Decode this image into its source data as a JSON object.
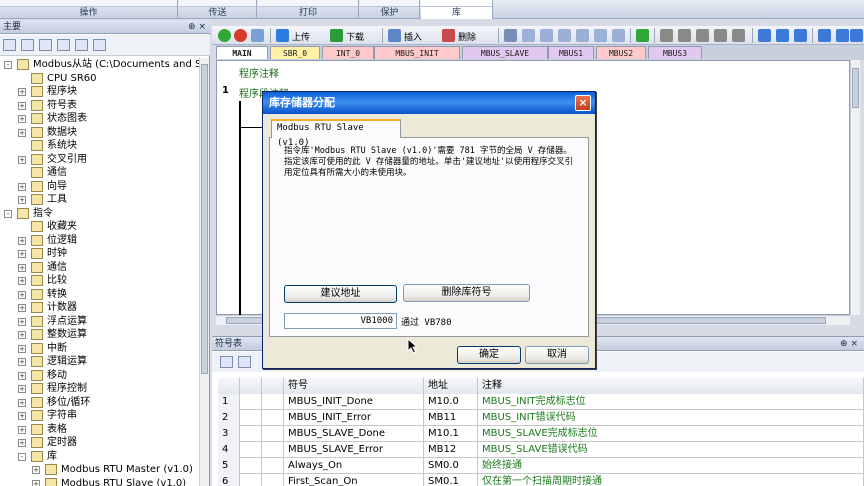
{
  "ribbon": {
    "groups": [
      "操作",
      "传送",
      "打印",
      "保护",
      "库"
    ]
  },
  "left_panel": {
    "title": "主要",
    "pin": "⊕ ×",
    "tree": [
      {
        "label": "Modbus从站 (C:\\Documents and Setting",
        "icon": "project-icon"
      },
      {
        "label": "CPU SR60",
        "icon": "cpu-icon"
      },
      {
        "label": "程序块",
        "icon": "folder-icon"
      },
      {
        "label": "符号表",
        "icon": "folder-icon"
      },
      {
        "label": "状态图表",
        "icon": "folder-icon"
      },
      {
        "label": "数据块",
        "icon": "folder-icon"
      },
      {
        "label": "系统块",
        "icon": "system-block-icon"
      },
      {
        "label": "交叉引用",
        "icon": "folder-icon"
      },
      {
        "label": "通信",
        "icon": "communication-icon"
      },
      {
        "label": "向导",
        "icon": "wizard-icon"
      },
      {
        "label": "工具",
        "icon": "folder-icon"
      },
      {
        "label": "指令",
        "icon": "folder-icon"
      },
      {
        "label": "收藏夹",
        "icon": "folder-icon"
      },
      {
        "label": "位逻辑",
        "icon": "folder-icon"
      },
      {
        "label": "时钟",
        "icon": "clock-icon"
      },
      {
        "label": "通信",
        "icon": "folder-icon"
      },
      {
        "label": "比较",
        "icon": "folder-icon"
      },
      {
        "label": "转换",
        "icon": "folder-icon"
      },
      {
        "label": "计数器",
        "icon": "folder-icon"
      },
      {
        "label": "浮点运算",
        "icon": "folder-icon"
      },
      {
        "label": "整数运算",
        "icon": "folder-icon"
      },
      {
        "label": "中断",
        "icon": "folder-icon"
      },
      {
        "label": "逻辑运算",
        "icon": "folder-icon"
      },
      {
        "label": "移动",
        "icon": "folder-icon"
      },
      {
        "label": "程序控制",
        "icon": "folder-icon"
      },
      {
        "label": "移位/循环",
        "icon": "folder-icon"
      },
      {
        "label": "字符串",
        "icon": "folder-icon"
      },
      {
        "label": "表格",
        "icon": "folder-icon"
      },
      {
        "label": "定时器",
        "icon": "folder-icon"
      },
      {
        "label": "库",
        "icon": "folder-icon"
      },
      {
        "label": "Modbus RTU Master (v1.0)",
        "icon": "folder-icon"
      },
      {
        "label": "Modbus RTU Slave (v1.0)",
        "icon": "folder-icon"
      }
    ]
  },
  "editor_toolbar": {
    "upload": "上传",
    "download": "下载",
    "insert": "插入",
    "delete": "删除"
  },
  "editor_tabs": [
    "MAIN",
    "SBR_0",
    "INT_0",
    "MBUS_INIT",
    "MBUS_SLAVE",
    "MBUS1",
    "MBUS2",
    "MBUS3"
  ],
  "editor": {
    "program_comment": "程序注释",
    "network_number": "1",
    "network_label": "程序段注释"
  },
  "symbol_table": {
    "title": "符号表",
    "pin": "⊕ ×",
    "columns": [
      "",
      "",
      "",
      "符号",
      "地址",
      "注释"
    ],
    "rows": [
      {
        "num": "1",
        "symbol": "MBUS_INIT_Done",
        "address": "M10.0",
        "comment": "MBUS_INIT完成标志位"
      },
      {
        "num": "2",
        "symbol": "MBUS_INIT_Error",
        "address": "MB11",
        "comment": "MBUS_INIT错误代码"
      },
      {
        "num": "3",
        "symbol": "MBUS_SLAVE_Done",
        "address": "M10.1",
        "comment": "MBUS_SLAVE完成标志位"
      },
      {
        "num": "4",
        "symbol": "MBUS_SLAVE_Error",
        "address": "MB12",
        "comment": "MBUS_SLAVE错误代码"
      },
      {
        "num": "5",
        "symbol": "Always_On",
        "address": "SM0.0",
        "comment": "始终接通"
      },
      {
        "num": "6",
        "symbol": "First_Scan_On",
        "address": "SM0.1",
        "comment": "仅在第一个扫描周期时接通"
      }
    ]
  },
  "dialog": {
    "title": "库存储器分配",
    "close_label": "×",
    "tab": "Modbus RTU Slave (v1.0)",
    "description": "指令库'Modbus RTU Slave (v1.0)'需要 781 字节的全局 V 存储器。指定该库可使用的此 V 存储器量的地址。单击'建议地址'以使用程序交叉引用定位具有所需大小的未使用块。",
    "suggest_button": "建议地址",
    "delete_symbols_button": "删除库符号",
    "address_value": "VB1000",
    "address_through": "通过 VB780",
    "ok_button": "确定",
    "cancel_button": "取消"
  },
  "colors": {
    "title_bar": "#0a5fd8",
    "comment_green": "#1a7a1a",
    "tab_main": "#ffffff",
    "tab_sbr": "#fff2a8",
    "tab_int": "#ffc9c9",
    "tab_mbus": "#e0c8f0"
  }
}
